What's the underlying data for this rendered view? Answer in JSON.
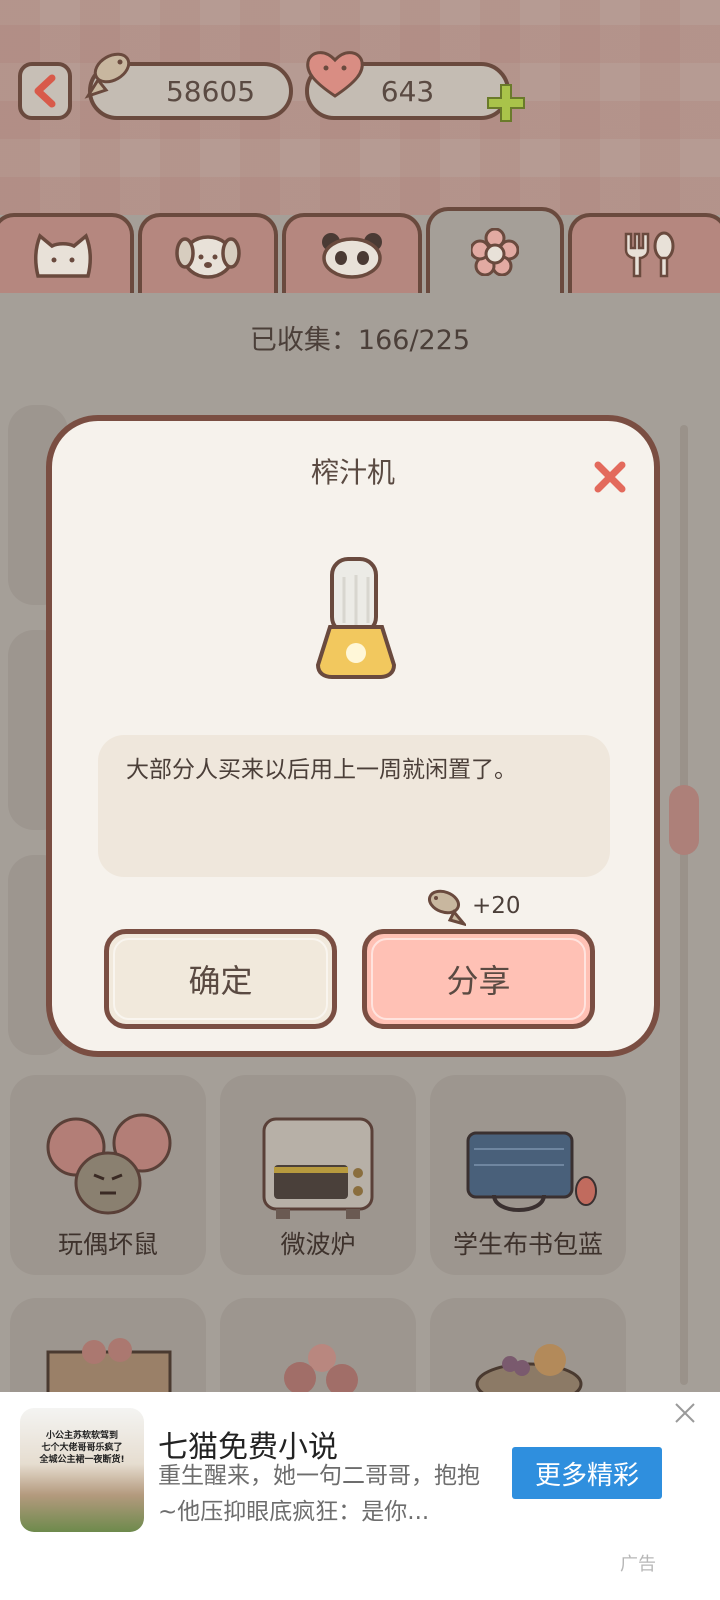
{
  "currency": {
    "fish": "58605",
    "hearts": "643"
  },
  "tabs": [
    {
      "icon": "cat-icon"
    },
    {
      "icon": "dog-icon"
    },
    {
      "icon": "panda-icon"
    },
    {
      "icon": "flower-icon",
      "active": true
    },
    {
      "icon": "fork-spoon-icon"
    }
  ],
  "collection": {
    "label": "已收集：166/225"
  },
  "grid": {
    "items": [
      "玩偶坏鼠",
      "微波炉",
      "学生布书包蓝"
    ]
  },
  "modal": {
    "title": "榨汁机",
    "description": "大部分人买来以后用上一周就闲置了。",
    "reward": "+20",
    "confirm_label": "确定",
    "share_label": "分享"
  },
  "ad": {
    "thumb_text": "小公主苏软软驾到\n七个大佬哥哥乐疯了\n全城公主裙一夜断货!",
    "title": "七猫免费小说",
    "description": "重生醒来，她一句二哥哥，抱抱~他压抑眼底疯狂：是你...",
    "cta": "更多精彩",
    "label": "广告"
  },
  "colors": {
    "accent": "#ffc1b5",
    "border": "#7a4e42",
    "ad_button": "#2f8fde"
  }
}
